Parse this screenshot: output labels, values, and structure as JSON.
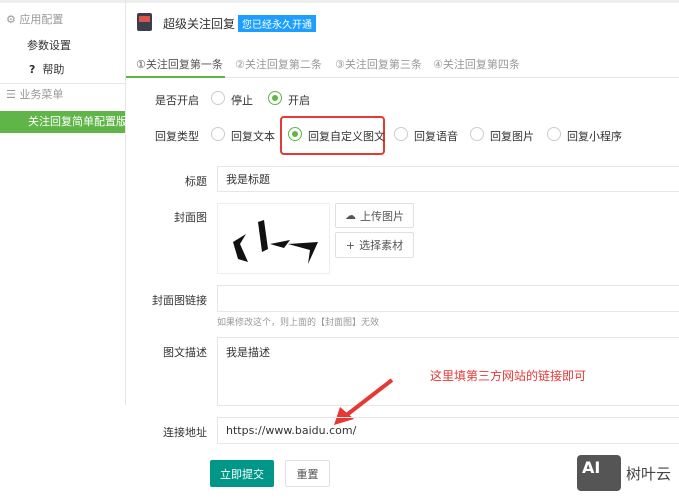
{
  "sidebar": {
    "section1": "应用配置",
    "item_params": "参数设置",
    "help_icon": "?",
    "item_help": "帮助",
    "section2": "业务菜单",
    "active_item": "关注回复简单配置版"
  },
  "header": {
    "title": "超级关注回复",
    "badge": "您已经永久开通"
  },
  "tabs": [
    "①关注回复第一条",
    "②关注回复第二条",
    "③关注回复第三条",
    "④关注回复第四条"
  ],
  "form": {
    "enable_label": "是否开启",
    "enable_options": [
      "停止",
      "开启"
    ],
    "type_label": "回复类型",
    "type_options": [
      "回复文本",
      "回复自定义图文",
      "回复语音",
      "回复图片",
      "回复小程序"
    ],
    "title_label": "标题",
    "title_value": "我是标题",
    "cover_label": "封面图",
    "upload_btn": "上传图片",
    "select_btn": "选择素材",
    "cover_link_label": "封面图链接",
    "cover_link_value": "",
    "cover_link_hint": "如果修改这个，则上面的【封面图】无效",
    "desc_label": "图文描述",
    "desc_value": "我是描述",
    "url_label": "连接地址",
    "url_value": "https://www.baidu.com/",
    "submit": "立即提交",
    "reset": "重置"
  },
  "annotation": "这里填第三方网站的链接即可",
  "watermark": {
    "logo": "AI",
    "text": "树叶云"
  }
}
